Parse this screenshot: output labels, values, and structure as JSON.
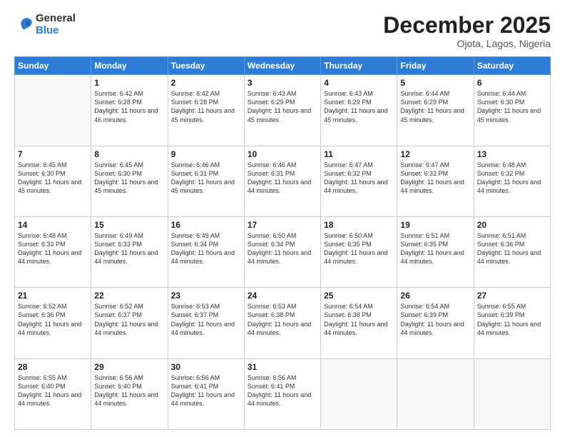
{
  "logo": {
    "general": "General",
    "blue": "Blue"
  },
  "header": {
    "month": "December 2025",
    "location": "Ojota, Lagos, Nigeria"
  },
  "weekdays": [
    "Sunday",
    "Monday",
    "Tuesday",
    "Wednesday",
    "Thursday",
    "Friday",
    "Saturday"
  ],
  "weeks": [
    [
      {
        "day": "",
        "sunrise": "",
        "sunset": "",
        "daylight": ""
      },
      {
        "day": "1",
        "sunrise": "Sunrise: 6:42 AM",
        "sunset": "Sunset: 6:28 PM",
        "daylight": "Daylight: 11 hours and 46 minutes."
      },
      {
        "day": "2",
        "sunrise": "Sunrise: 6:42 AM",
        "sunset": "Sunset: 6:28 PM",
        "daylight": "Daylight: 11 hours and 45 minutes."
      },
      {
        "day": "3",
        "sunrise": "Sunrise: 6:43 AM",
        "sunset": "Sunset: 6:29 PM",
        "daylight": "Daylight: 11 hours and 45 minutes."
      },
      {
        "day": "4",
        "sunrise": "Sunrise: 6:43 AM",
        "sunset": "Sunset: 6:29 PM",
        "daylight": "Daylight: 11 hours and 45 minutes."
      },
      {
        "day": "5",
        "sunrise": "Sunrise: 6:44 AM",
        "sunset": "Sunset: 6:29 PM",
        "daylight": "Daylight: 11 hours and 45 minutes."
      },
      {
        "day": "6",
        "sunrise": "Sunrise: 6:44 AM",
        "sunset": "Sunset: 6:30 PM",
        "daylight": "Daylight: 11 hours and 45 minutes."
      }
    ],
    [
      {
        "day": "7",
        "sunrise": "Sunrise: 6:45 AM",
        "sunset": "Sunset: 6:30 PM",
        "daylight": "Daylight: 11 hours and 45 minutes."
      },
      {
        "day": "8",
        "sunrise": "Sunrise: 6:45 AM",
        "sunset": "Sunset: 6:30 PM",
        "daylight": "Daylight: 11 hours and 45 minutes."
      },
      {
        "day": "9",
        "sunrise": "Sunrise: 6:46 AM",
        "sunset": "Sunset: 6:31 PM",
        "daylight": "Daylight: 11 hours and 45 minutes."
      },
      {
        "day": "10",
        "sunrise": "Sunrise: 6:46 AM",
        "sunset": "Sunset: 6:31 PM",
        "daylight": "Daylight: 11 hours and 44 minutes."
      },
      {
        "day": "11",
        "sunrise": "Sunrise: 6:47 AM",
        "sunset": "Sunset: 6:32 PM",
        "daylight": "Daylight: 11 hours and 44 minutes."
      },
      {
        "day": "12",
        "sunrise": "Sunrise: 6:47 AM",
        "sunset": "Sunset: 6:32 PM",
        "daylight": "Daylight: 11 hours and 44 minutes."
      },
      {
        "day": "13",
        "sunrise": "Sunrise: 6:48 AM",
        "sunset": "Sunset: 6:32 PM",
        "daylight": "Daylight: 11 hours and 44 minutes."
      }
    ],
    [
      {
        "day": "14",
        "sunrise": "Sunrise: 6:48 AM",
        "sunset": "Sunset: 6:33 PM",
        "daylight": "Daylight: 11 hours and 44 minutes."
      },
      {
        "day": "15",
        "sunrise": "Sunrise: 6:49 AM",
        "sunset": "Sunset: 6:33 PM",
        "daylight": "Daylight: 11 hours and 44 minutes."
      },
      {
        "day": "16",
        "sunrise": "Sunrise: 6:49 AM",
        "sunset": "Sunset: 6:34 PM",
        "daylight": "Daylight: 11 hours and 44 minutes."
      },
      {
        "day": "17",
        "sunrise": "Sunrise: 6:50 AM",
        "sunset": "Sunset: 6:34 PM",
        "daylight": "Daylight: 11 hours and 44 minutes."
      },
      {
        "day": "18",
        "sunrise": "Sunrise: 6:50 AM",
        "sunset": "Sunset: 6:35 PM",
        "daylight": "Daylight: 11 hours and 44 minutes."
      },
      {
        "day": "19",
        "sunrise": "Sunrise: 6:51 AM",
        "sunset": "Sunset: 6:35 PM",
        "daylight": "Daylight: 11 hours and 44 minutes."
      },
      {
        "day": "20",
        "sunrise": "Sunrise: 6:51 AM",
        "sunset": "Sunset: 6:36 PM",
        "daylight": "Daylight: 11 hours and 44 minutes."
      }
    ],
    [
      {
        "day": "21",
        "sunrise": "Sunrise: 6:52 AM",
        "sunset": "Sunset: 6:36 PM",
        "daylight": "Daylight: 11 hours and 44 minutes."
      },
      {
        "day": "22",
        "sunrise": "Sunrise: 6:52 AM",
        "sunset": "Sunset: 6:37 PM",
        "daylight": "Daylight: 11 hours and 44 minutes."
      },
      {
        "day": "23",
        "sunrise": "Sunrise: 6:53 AM",
        "sunset": "Sunset: 6:37 PM",
        "daylight": "Daylight: 11 hours and 44 minutes."
      },
      {
        "day": "24",
        "sunrise": "Sunrise: 6:53 AM",
        "sunset": "Sunset: 6:38 PM",
        "daylight": "Daylight: 11 hours and 44 minutes."
      },
      {
        "day": "25",
        "sunrise": "Sunrise: 6:54 AM",
        "sunset": "Sunset: 6:38 PM",
        "daylight": "Daylight: 11 hours and 44 minutes."
      },
      {
        "day": "26",
        "sunrise": "Sunrise: 6:54 AM",
        "sunset": "Sunset: 6:39 PM",
        "daylight": "Daylight: 11 hours and 44 minutes."
      },
      {
        "day": "27",
        "sunrise": "Sunrise: 6:55 AM",
        "sunset": "Sunset: 6:39 PM",
        "daylight": "Daylight: 11 hours and 44 minutes."
      }
    ],
    [
      {
        "day": "28",
        "sunrise": "Sunrise: 6:55 AM",
        "sunset": "Sunset: 6:40 PM",
        "daylight": "Daylight: 11 hours and 44 minutes."
      },
      {
        "day": "29",
        "sunrise": "Sunrise: 6:56 AM",
        "sunset": "Sunset: 6:40 PM",
        "daylight": "Daylight: 11 hours and 44 minutes."
      },
      {
        "day": "30",
        "sunrise": "Sunrise: 6:56 AM",
        "sunset": "Sunset: 6:41 PM",
        "daylight": "Daylight: 11 hours and 44 minutes."
      },
      {
        "day": "31",
        "sunrise": "Sunrise: 6:56 AM",
        "sunset": "Sunset: 6:41 PM",
        "daylight": "Daylight: 11 hours and 44 minutes."
      },
      {
        "day": "",
        "sunrise": "",
        "sunset": "",
        "daylight": ""
      },
      {
        "day": "",
        "sunrise": "",
        "sunset": "",
        "daylight": ""
      },
      {
        "day": "",
        "sunrise": "",
        "sunset": "",
        "daylight": ""
      }
    ]
  ]
}
